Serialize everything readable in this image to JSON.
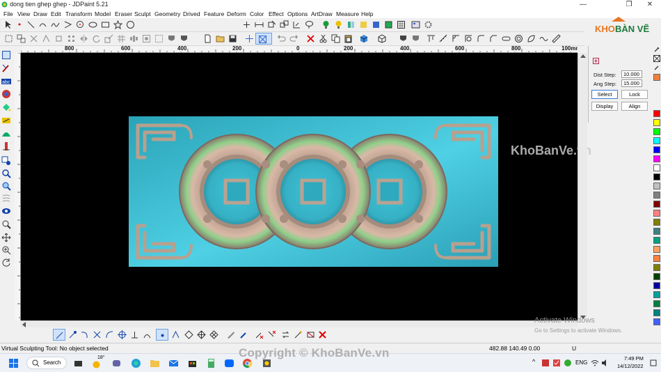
{
  "window": {
    "title": "dong tien ghep ghep - JDPaint 5.21",
    "minimize": "—",
    "maximize": "❐",
    "close": "✕"
  },
  "menu": [
    "File",
    "View",
    "Draw",
    "Edit",
    "Transform",
    "Model",
    "Eraser",
    "Sculpt",
    "Geometry",
    "Drived",
    "Feature",
    "Deform",
    "Color",
    "Effect",
    "Options",
    "ArtDraw",
    "Measure",
    "Help"
  ],
  "logo": {
    "text_a": "KHO",
    "text_b": "BÀN VẼ"
  },
  "ruler": {
    "labels": [
      "800",
      "600",
      "400",
      "200",
      "0",
      "200",
      "400",
      "600",
      "800",
      "100mm"
    ]
  },
  "right_panel": {
    "dist_step_label": "Dist Step:",
    "dist_step_value": "10.000",
    "ang_step_label": "Ang Step:",
    "ang_step_value": "15.000",
    "select_btn": "Select",
    "lock_btn": "Lock",
    "display_btn": "Display",
    "align_btn": "Align"
  },
  "palette": [
    "#ff0000",
    "#ffff00",
    "#00ff00",
    "#00ffff",
    "#0000ff",
    "#ff00ff",
    "#ffffff",
    "#000000",
    "#c0c0c0",
    "#808080",
    "#800000",
    "#ff8080",
    "#808000",
    "#408080",
    "#00a080",
    "#ffa060",
    "#ff8040",
    "#808000",
    "#004000",
    "#0000a0",
    "#00a0a0",
    "#008040",
    "#008080",
    "#4060ff",
    "#a0a0c0",
    "#8080a0"
  ],
  "viewport": {
    "watermark": "KhoBanVe.vn",
    "colors": {
      "background": "#000000",
      "relief": "#3bb5c9"
    }
  },
  "status": {
    "message": "Virtual Sculpting Tool: No object selected",
    "coords": "482.88 140.49 0.00",
    "mode": "U"
  },
  "activation": {
    "title": "Activate Windows",
    "subtitle": "Go to Settings to activate Windows."
  },
  "copyright": "Copyright © KhoBanVe.vn",
  "taskbar": {
    "search": "Search",
    "weather": "18°",
    "lang": "ENG",
    "time": "7:49 PM",
    "date": "14/12/2022"
  }
}
